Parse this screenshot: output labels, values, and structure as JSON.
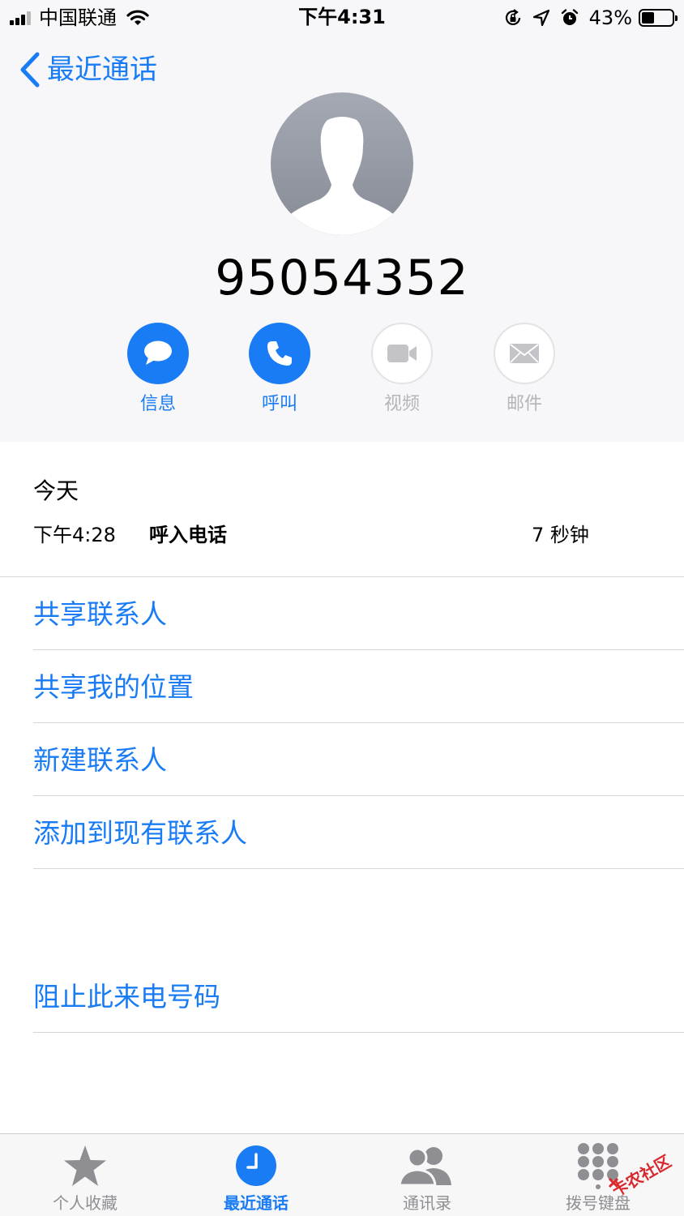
{
  "status_bar": {
    "carrier": "中国联通",
    "time": "下午4:31",
    "battery_percent": "43%",
    "battery_level": 0.43,
    "icons": [
      "signal-icon",
      "wifi-icon",
      "orientation-lock-icon",
      "location-icon",
      "alarm-icon",
      "battery-icon"
    ]
  },
  "nav": {
    "back_label": "最近通话",
    "back_icon": "chevron-left-icon"
  },
  "contact": {
    "number": "95054352",
    "avatar_icon": "person-silhouette-icon"
  },
  "actions": [
    {
      "label": "信息",
      "icon": "message-bubble-icon",
      "enabled": true
    },
    {
      "label": "呼叫",
      "icon": "phone-icon",
      "enabled": true
    },
    {
      "label": "视频",
      "icon": "video-camera-icon",
      "enabled": false
    },
    {
      "label": "邮件",
      "icon": "envelope-icon",
      "enabled": false
    }
  ],
  "recents": {
    "day": "今天",
    "calls": [
      {
        "time": "下午4:28",
        "type": "呼入电话",
        "duration": "7 秒钟"
      }
    ]
  },
  "options": [
    {
      "label": "共享联系人"
    },
    {
      "label": "共享我的位置"
    },
    {
      "label": "新建联系人"
    },
    {
      "label": "添加到现有联系人"
    }
  ],
  "block_option": {
    "label": "阻止此来电号码"
  },
  "tabbar": {
    "tabs": [
      {
        "label": "个人收藏",
        "icon": "star-icon",
        "active": false
      },
      {
        "label": "最近通话",
        "icon": "clock-icon",
        "active": true
      },
      {
        "label": "通讯录",
        "icon": "contacts-icon",
        "active": false
      },
      {
        "label": "拨号键盘",
        "icon": "keypad-icon",
        "active": false
      }
    ]
  },
  "watermark": {
    "text": "卡农社区"
  },
  "colors": {
    "accent": "#1a7cf5",
    "disabled": "#b5b5b9",
    "separator": "#d6d6da",
    "header_bg": "#f7f7f9"
  }
}
